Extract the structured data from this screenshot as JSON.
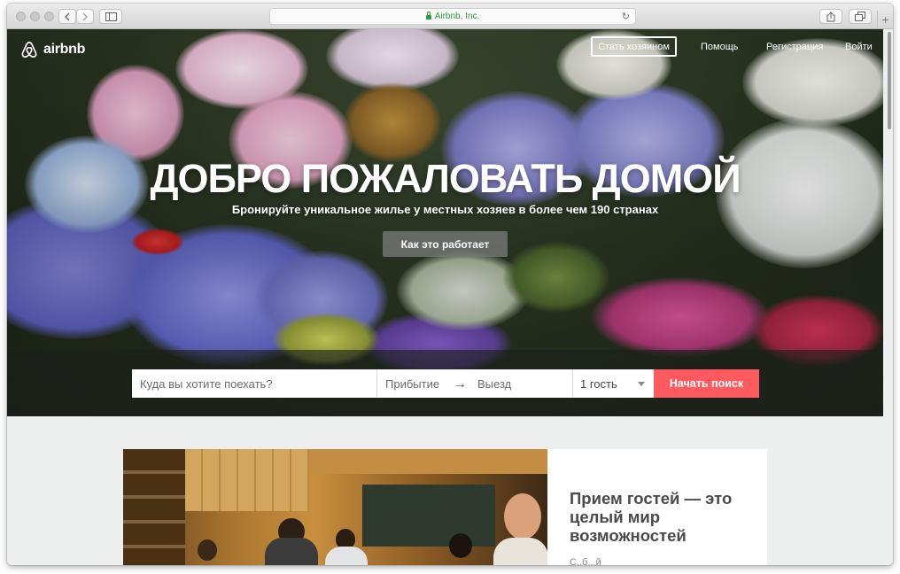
{
  "browser": {
    "url": "Airbnb, Inc.",
    "icons": [
      "back-icon",
      "forward-icon",
      "sidebar-icon",
      "lock-icon",
      "reload-icon",
      "share-icon",
      "tabs-icon",
      "new-tab-icon"
    ],
    "new_tab_label": "+"
  },
  "header": {
    "logo_text": "airbnb",
    "host_button": "Стать хозяином",
    "links": [
      "Помощь",
      "Регистрация",
      "Войти"
    ]
  },
  "hero": {
    "title": "ДОБРО ПОЖАЛОВАТЬ ДОМОЙ",
    "subtitle": "Бронируйте уникальное жилье у местных хозяев в более чем 190 странах",
    "how_button": "Как это работает"
  },
  "search": {
    "where_placeholder": "Куда вы хотите поехать?",
    "checkin_placeholder": "Прибытие",
    "checkout_placeholder": "Выезд",
    "arrow": "→",
    "guests_value": "1 гость",
    "submit": "Начать поиск"
  },
  "card": {
    "heading": "Прием гостей — это целый мир возможностей",
    "text": "С..б...й"
  },
  "colors": {
    "accent": "#ff5a5f",
    "secure": "#2b9c3a"
  }
}
